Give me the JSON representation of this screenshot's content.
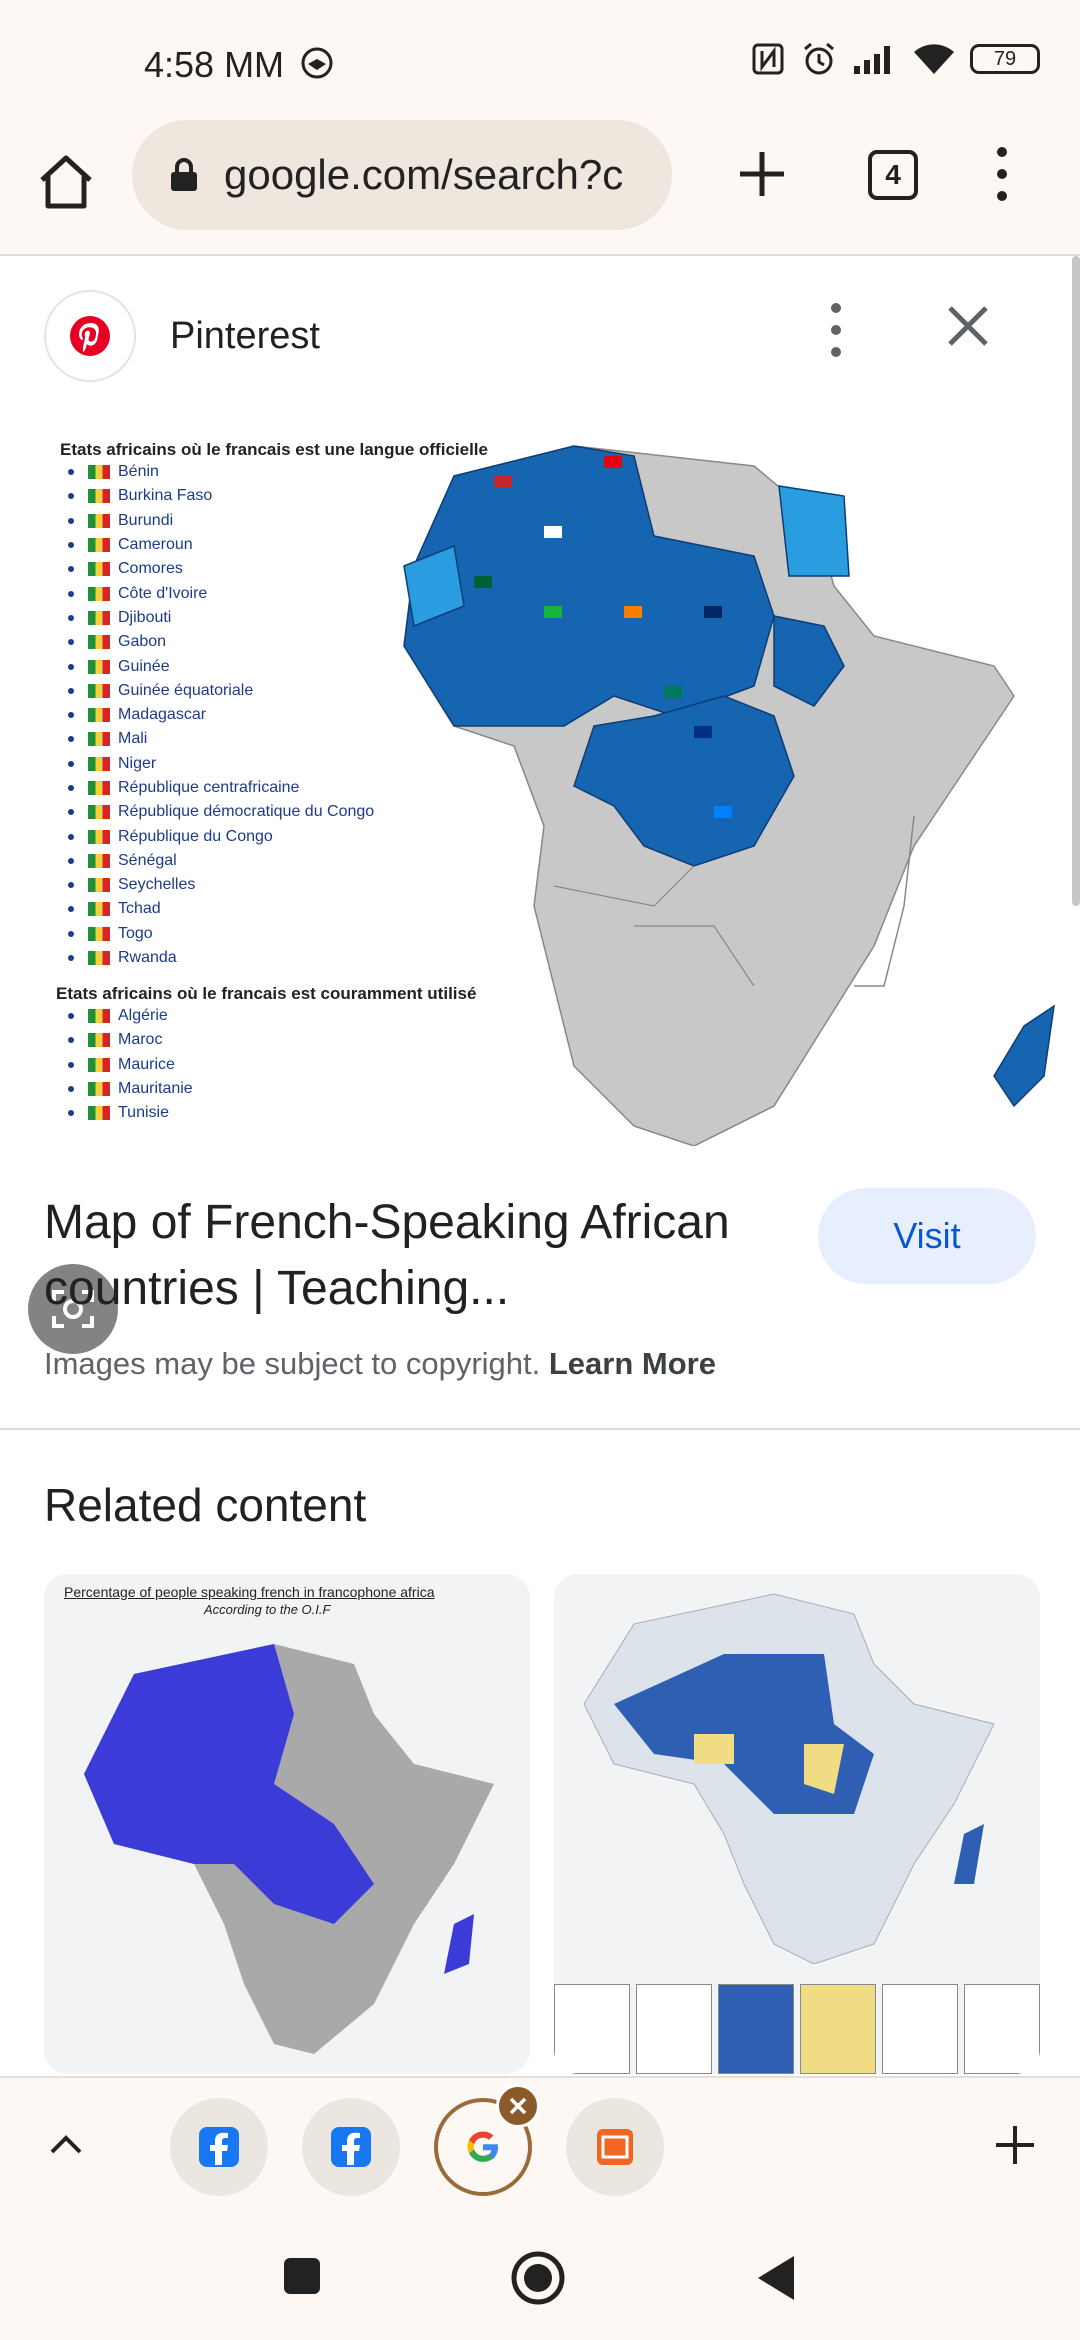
{
  "status": {
    "time": "4:58 MM",
    "battery": "79"
  },
  "toolbar": {
    "url": "google.com/search?c",
    "tab_count": "4"
  },
  "card": {
    "source": "Pinterest",
    "map": {
      "list1_title": "Etats africains où le francais est une langue officielle",
      "list1": [
        "Bénin",
        "Burkina Faso",
        "Burundi",
        "Cameroun",
        "Comores",
        "Côte d'Ivoire",
        "Djibouti",
        "Gabon",
        "Guinée",
        "Guinée équatoriale",
        "Madagascar",
        "Mali",
        "Niger",
        "République centrafricaine",
        "République démocratique du Congo",
        "République du Congo",
        "Sénégal",
        "Seychelles",
        "Tchad",
        "Togo",
        "Rwanda"
      ],
      "list2_title": "Etats africains où le francais est couramment utilisé",
      "list2": [
        "Algérie",
        "Maroc",
        "Maurice",
        "Mauritanie",
        "Tunisie"
      ]
    },
    "title": "Map of French-Speaking African countries | Teaching...",
    "visit": "Visit",
    "copyright": "Images may be subject to copyright.",
    "learn_more": "Learn More"
  },
  "related": {
    "title": "Related content",
    "thumb1_title": "Percentage of people speaking french in francophone africa",
    "thumb1_subtitle": "According to the O.I.F"
  },
  "colors": {
    "map_blue": "#1565b0",
    "map_light": "#2a9de0",
    "map_grey": "#c8c8c8",
    "accent": "#0b57d0"
  }
}
